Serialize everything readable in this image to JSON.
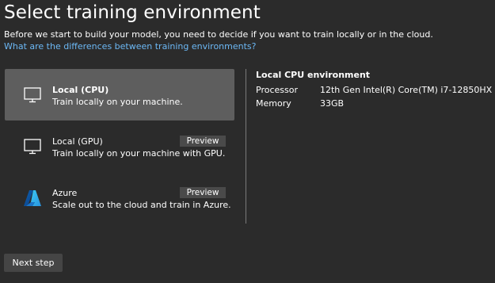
{
  "header": {
    "title": "Select training environment",
    "subtitle": "Before we start to build your model, you need to decide if you want to train locally or in the cloud.",
    "link": "What are the differences between training environments?"
  },
  "options": [
    {
      "title": "Local (CPU)",
      "description": "Train locally on your machine.",
      "icon": "monitor-icon",
      "selected": true
    },
    {
      "title": "Local (GPU)",
      "description": "Train locally on your machine with GPU.",
      "icon": "monitor-icon",
      "badge": "Preview"
    },
    {
      "title": "Azure",
      "description": "Scale out to the cloud and train in Azure.",
      "icon": "azure-logo-icon",
      "badge": "Preview"
    }
  ],
  "details": {
    "title": "Local CPU environment",
    "rows": [
      {
        "key": "Processor",
        "value": "12th Gen Intel(R) Core(TM) i7-12850HX"
      },
      {
        "key": "Memory",
        "value": "33GB"
      }
    ]
  },
  "footer": {
    "next_label": "Next step"
  },
  "colors": {
    "background": "#2b2b2b",
    "selected": "#5e5e5e",
    "link": "#6cb8f5",
    "badge": "#4a4a4a",
    "button": "#454545"
  }
}
